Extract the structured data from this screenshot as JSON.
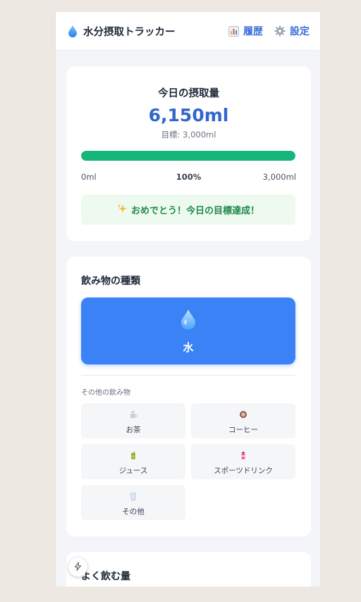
{
  "header": {
    "title": "水分摂取トラッカー",
    "history_label": "履歴",
    "settings_label": "設定"
  },
  "summary": {
    "title": "今日の摂取量",
    "amount": "6,150ml",
    "goal": "目標: 3,000ml",
    "progress_fraction": 1.0,
    "min_label": "0ml",
    "percent_label": "100%",
    "max_label": "3,000ml",
    "message": "おめでとう！今日の目標達成！"
  },
  "drinks": {
    "title": "飲み物の種類",
    "primary_label": "水",
    "other_title": "その他の飲み物",
    "others": [
      {
        "label": "お茶",
        "icon": "tea-icon"
      },
      {
        "label": "コーヒー",
        "icon": "coffee-icon"
      },
      {
        "label": "ジュース",
        "icon": "juice-icon"
      },
      {
        "label": "スポーツドリンク",
        "icon": "sports-drink-icon"
      },
      {
        "label": "その他",
        "icon": "cup-icon"
      }
    ]
  },
  "amounts": {
    "title": "よく飲む量"
  },
  "colors": {
    "accent": "#3b82f6",
    "progress": "#16b57a",
    "link": "#3b6fd8"
  }
}
